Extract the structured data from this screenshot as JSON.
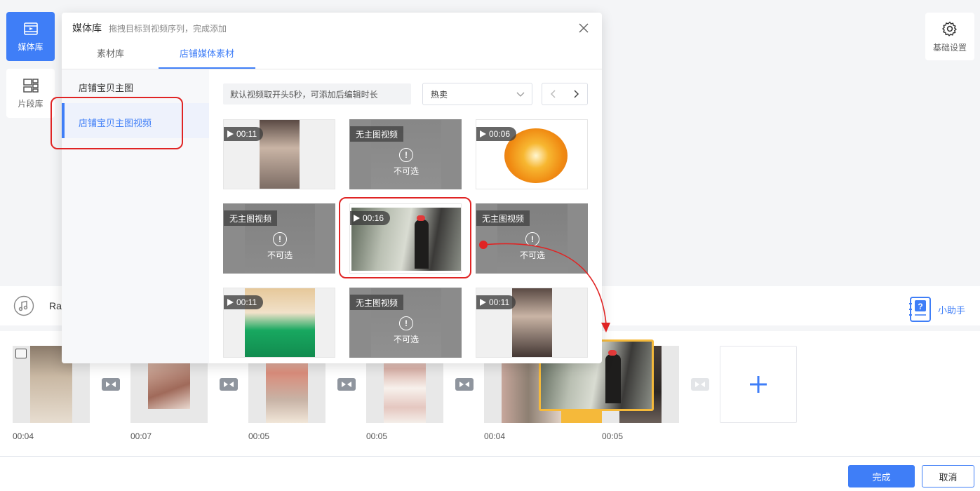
{
  "sidebar": {
    "media_library": "媒体库",
    "clip_library": "片段库"
  },
  "settings": {
    "label": "基础设置"
  },
  "dialog": {
    "title": "媒体库",
    "subtitle": "拖拽目标到视频序列，完成添加",
    "tabs": [
      "素材库",
      "店铺媒体素材"
    ],
    "categories": [
      "店铺宝贝主图",
      "店铺宝贝主图视频"
    ],
    "hint": "默认视频取开头5秒，可添加后编辑时长",
    "sort_value": "热卖",
    "tiles": [
      {
        "badge": "00:11",
        "disabled": false
      },
      {
        "badge": "无主图视频",
        "disabled": true,
        "status": "不可选"
      },
      {
        "badge": "00:06",
        "disabled": false
      },
      {
        "badge": "无主图视频",
        "disabled": true,
        "status": "不可选"
      },
      {
        "badge": "00:16",
        "disabled": false
      },
      {
        "badge": "无主图视频",
        "disabled": true,
        "status": "不可选"
      },
      {
        "badge": "00:11",
        "disabled": false
      },
      {
        "badge": "无主图视频",
        "disabled": true,
        "status": "不可选"
      },
      {
        "badge": "00:11",
        "disabled": false
      }
    ]
  },
  "music": {
    "name": "Rai"
  },
  "helper": {
    "label": "小助手"
  },
  "timeline": {
    "durations": [
      "00:04",
      "00:07",
      "00:05",
      "00:05",
      "00:04",
      "00:05"
    ]
  },
  "footer": {
    "done": "完成",
    "cancel": "取消"
  },
  "colors": {
    "accent": "#3f7ef7",
    "highlight": "#e02424",
    "drop": "#f5b93a"
  }
}
